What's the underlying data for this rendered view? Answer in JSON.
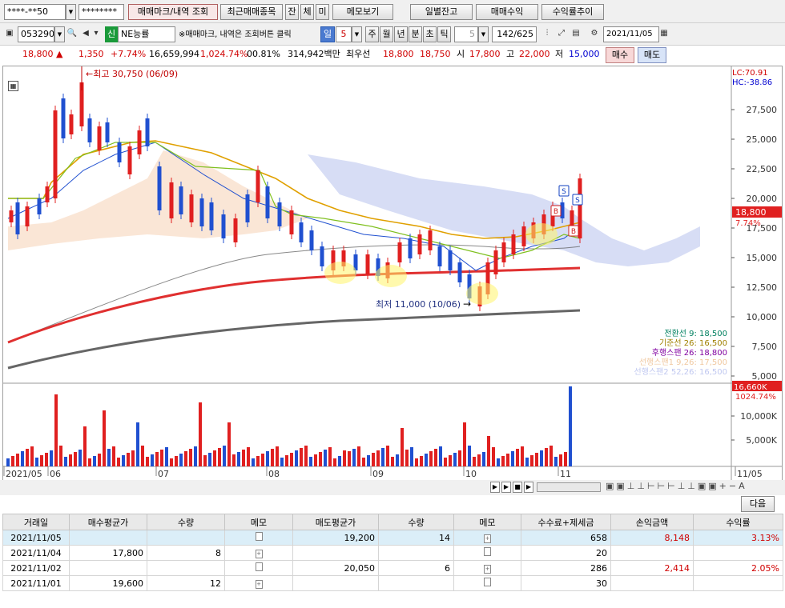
{
  "toolbar1": {
    "account": "****-**50",
    "password": "********",
    "tab_trade_mark": "매매마크/내역 조회",
    "tab_recent": "최근매매종목",
    "tab_jan": "잔",
    "tab_che": "체",
    "tab_mi": "미",
    "memo_view": "메모보기",
    "daily_balance": "일별잔고",
    "trade_profit": "매매수익",
    "return_trend": "수익률추이"
  },
  "toolbar2": {
    "code": "053290",
    "shin": "신",
    "stock_name": "NE능률",
    "note": "※매매마크, 내역은 조회버튼 클릭",
    "period": "일",
    "period_n": "5",
    "periods": [
      "주",
      "월",
      "년",
      "분",
      "초",
      "틱"
    ],
    "tick_n": "5",
    "count": "142/625",
    "date": "2021/11/05"
  },
  "price_bar": {
    "price": "18,800 ▲",
    "change": "1,350",
    "pct": "+7.74%",
    "volume": "16,659,994",
    "vol_pct": "1,024.74%",
    "turnover": "00.81%",
    "amount": "314,942백만",
    "priority": "최우선",
    "ask": "18,800",
    "bid": "18,750",
    "open_label": "시",
    "open": "17,800",
    "high_label": "고",
    "high": "22,000",
    "low_label": "저",
    "low": "15,000",
    "buy_btn": "매수",
    "sell_btn": "매도"
  },
  "chart": {
    "lc": "LC:70.91",
    "hc": "HC:-38.86",
    "max_label": "최고 30,750 (06/09)",
    "min_label": "최저 11,000 (10/06)",
    "price_ticks": [
      "27,500",
      "25,000",
      "22,500",
      "20,000",
      "17,500",
      "15,000",
      "12,500",
      "10,000",
      "7,500",
      "5,000"
    ],
    "vol_ticks": [
      "10,000K",
      "5,000K"
    ],
    "current_price": "18,800",
    "current_pct": "7.74%",
    "vol_current": "16,660K",
    "vol_current_pct": "1024.74%",
    "ichimoku": [
      {
        "label": "전환선 9: 18,500",
        "color": "#008060"
      },
      {
        "label": "기준선 26: 16,500",
        "color": "#a08000"
      },
      {
        "label": "후행스팬 26: 18,800",
        "color": "#8000a0"
      },
      {
        "label": "선행스팬1 9,26: 17,500",
        "color": "#f0c8a0"
      },
      {
        "label": "선행스팬2 52,26: 16,500",
        "color": "#c0c8f0"
      }
    ],
    "x_labels": [
      "2021/05",
      "06",
      "07",
      "08",
      "09",
      "10",
      "11",
      "11/05"
    ],
    "markers": [
      "S",
      "S",
      "B",
      "B"
    ]
  },
  "chart_ctrl": {
    "next": "다음"
  },
  "table": {
    "headers": [
      "거래일",
      "매수평균가",
      "수량",
      "메모",
      "매도평균가",
      "수량",
      "메모",
      "수수료+제세금",
      "손익금액",
      "수익률"
    ],
    "rows": [
      [
        "2021/11/05",
        "",
        "",
        "",
        "19,200",
        "14",
        "",
        "658",
        "8,148",
        "3.13%"
      ],
      [
        "2021/11/04",
        "17,800",
        "8",
        "",
        "",
        "",
        "",
        "20",
        "",
        ""
      ],
      [
        "2021/11/02",
        "",
        "",
        "",
        "20,050",
        "6",
        "",
        "286",
        "2,414",
        "2.05%"
      ],
      [
        "2021/11/01",
        "19,600",
        "12",
        "",
        "",
        "",
        "",
        "30",
        "",
        ""
      ]
    ]
  }
}
